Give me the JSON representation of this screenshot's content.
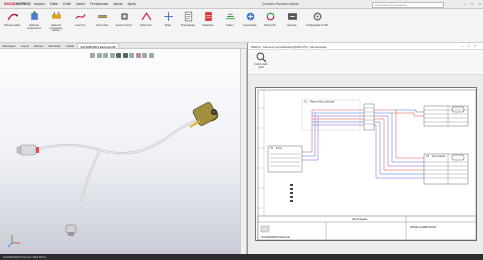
{
  "app": {
    "logo_brand": "SOLID",
    "logo_suffix": "WORKS",
    "doc_title": "Conector Harness chicote",
    "search_placeholder": "Comandos de pesquisa"
  },
  "menu": [
    "Arquivo",
    "Editar",
    "Exibir",
    "Inserir",
    "Ferramentas",
    "Janela",
    "Ajuda"
  ],
  "ribbon": {
    "buttons": [
      "Harness cables",
      "Adicionar componentes",
      "Adicionar componente elétrico",
      "Inserir fio",
      "Inserir cabo",
      "Inserir conector",
      "Editar rota",
      "Rotas",
      "Propriedades",
      "Relatórios",
      "Flatten",
      "Gerenciador",
      "Sincronizar",
      "Exportar",
      "Configuração do SW"
    ]
  },
  "command_tabs": [
    "Montagem",
    "Layout",
    "Esboço",
    "Marcação",
    "Avaliar",
    "SOLIDWORKS Electrical 3D"
  ],
  "active_tab": "SOLIDWORKS Electrical 3D",
  "dialog": {
    "title": "ZEM-D - Harness (cinzaModelo)[6181-PN] - Alimentação",
    "tool_label": "Definir visão geral",
    "sheet_title": "Alimentação",
    "blocks": [
      {
        "id": "X1",
        "label": "Plano elétrico principal"
      },
      {
        "id": "X2",
        "label": "Fonte"
      },
      {
        "id": "X3",
        "label": "Alimentação"
      }
    ],
    "company": "SOLIDWORKS Electrical",
    "revision": "PN6181-ALIMENTAÇÃO"
  },
  "status": {
    "text": "SOLIDWORKS Premium 2022 SP2.0"
  },
  "colors": {
    "accent": "#c8102e",
    "wire_red": "#e44c4c",
    "wire_blue": "#3a6edb",
    "wire_purple": "#8c4fd6"
  }
}
